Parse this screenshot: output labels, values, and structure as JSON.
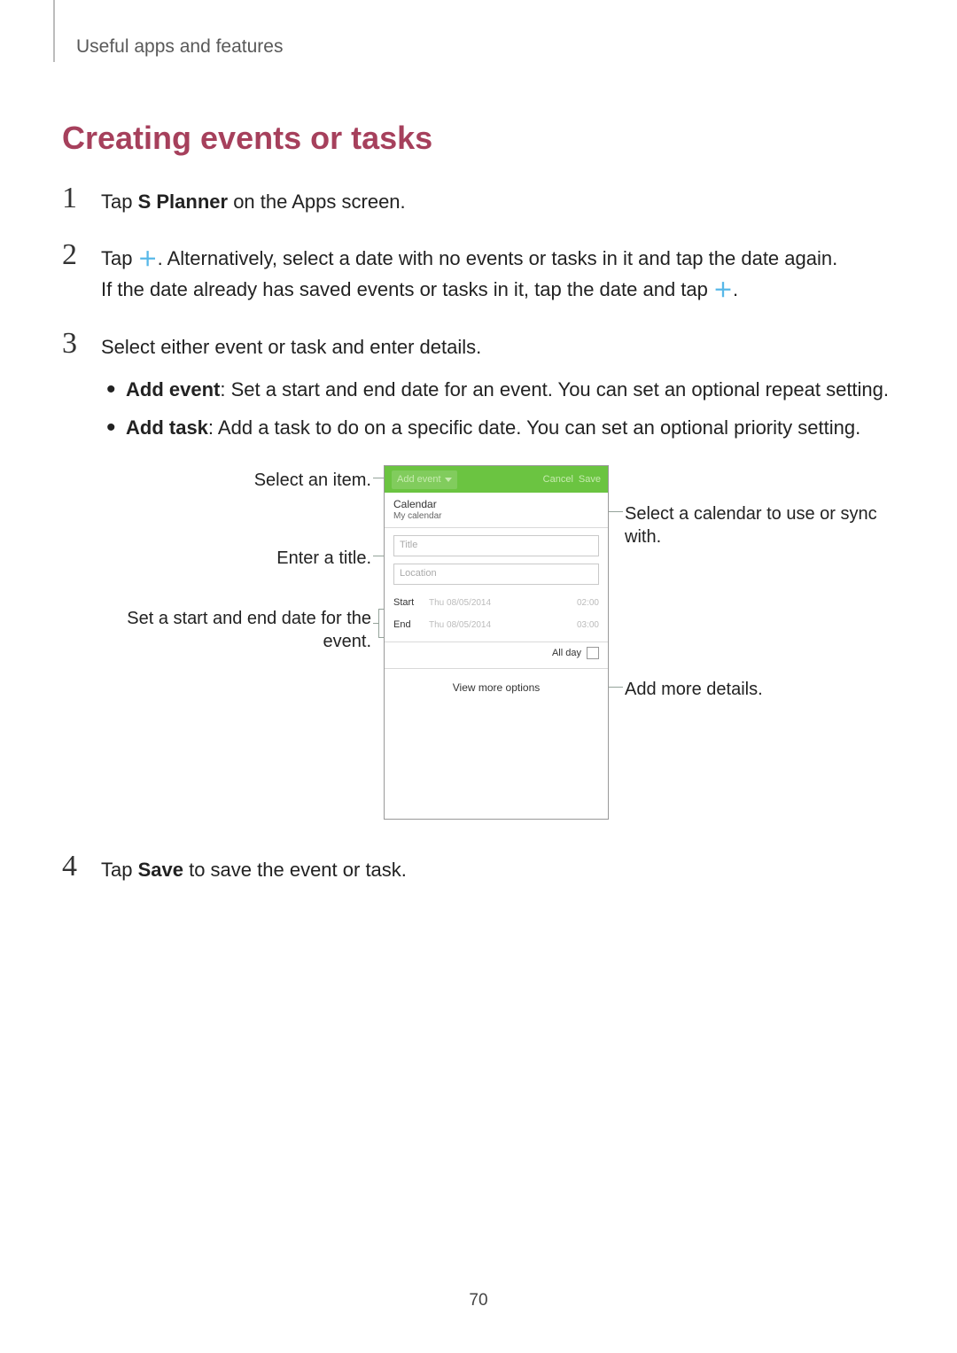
{
  "breadcrumb": "Useful apps and features",
  "section_title": "Creating events or tasks",
  "steps": [
    {
      "num": "1",
      "pre": "Tap ",
      "bold": "S Planner",
      "post": " on the Apps screen."
    },
    {
      "num": "2",
      "pre": "Tap ",
      "icon": "plus",
      "post": ". Alternatively, select a date with no events or tasks in it and tap the date again.",
      "line2_pre": "If the date already has saved events or tasks in it, tap the date and tap ",
      "line2_icon": "plus",
      "line2_post": "."
    },
    {
      "num": "3",
      "text": "Select either event or task and enter details.",
      "bullets": [
        {
          "bold": "Add event",
          "text": ": Set a start and end date for an event. You can set an optional repeat setting."
        },
        {
          "bold": "Add task",
          "text": ": Add a task to do on a specific date. You can set an optional priority setting."
        }
      ]
    },
    {
      "num": "4",
      "pre": "Tap ",
      "bold": "Save",
      "post": " to save the event or task."
    }
  ],
  "phone": {
    "header": {
      "add_event": "Add event",
      "cancel": "Cancel",
      "save": "Save"
    },
    "calendar_label": "Calendar",
    "calendar_value": "My calendar",
    "title_placeholder": "Title",
    "location_placeholder": "Location",
    "start_label": "Start",
    "start_date": "Thu 08/05/2014",
    "start_time": "02:00",
    "end_label": "End",
    "end_date": "Thu 08/05/2014",
    "end_time": "03:00",
    "all_day": "All day",
    "view_more": "View more options"
  },
  "callouts": {
    "select_item": "Select an item.",
    "enter_title": "Enter a title.",
    "start_end": "Set a start and end date for the event.",
    "select_calendar": "Select a calendar to use or sync with.",
    "add_more": "Add more details."
  },
  "page_number": "70"
}
